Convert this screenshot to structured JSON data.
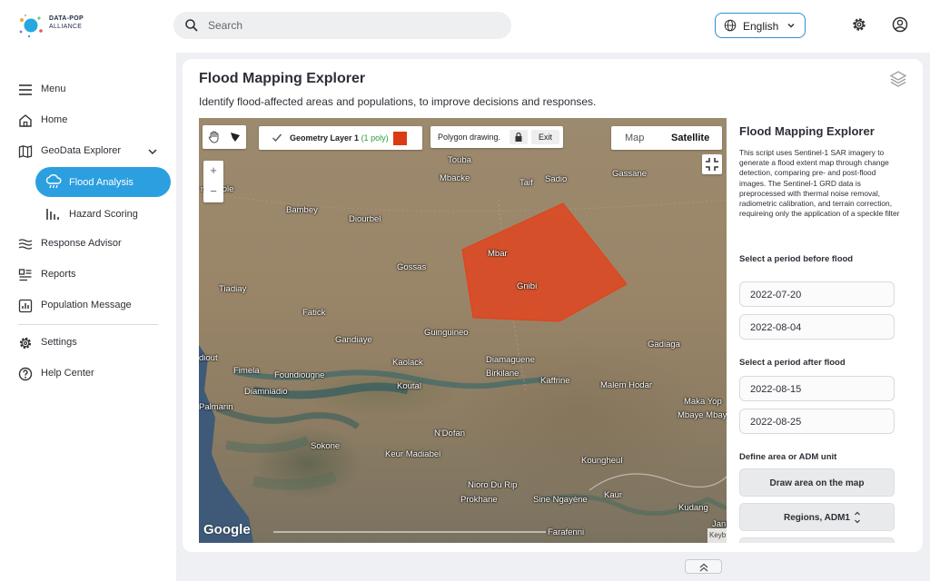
{
  "brand": {
    "line1": "DATA-POP",
    "line2": "ALLIANCE"
  },
  "search": {
    "placeholder": "Search"
  },
  "language": {
    "selected": "English"
  },
  "sidebar": {
    "items": [
      {
        "label": "Menu",
        "icon": "menu-icon"
      },
      {
        "label": "Home",
        "icon": "home-icon"
      },
      {
        "label": "GeoData Explorer",
        "icon": "map-icon"
      },
      {
        "label": "Flood Analysis",
        "icon": "cloud-rain-icon",
        "active": true
      },
      {
        "label": "Hazard Scoring",
        "icon": "bar-chart-icon"
      },
      {
        "label": "Response Advisor",
        "icon": "waves-icon"
      },
      {
        "label": "Reports",
        "icon": "reports-icon"
      },
      {
        "label": "Population Message",
        "icon": "population-icon"
      },
      {
        "label": "Settings",
        "icon": "gear-icon"
      },
      {
        "label": "Help Center",
        "icon": "help-icon"
      }
    ]
  },
  "page": {
    "title": "Flood Mapping Explorer",
    "subtitle": "Identify flood-affected areas and populations, to improve decisions and responses."
  },
  "map": {
    "geometry_layer": {
      "name": "Geometry Layer 1",
      "count": "(1 poly)",
      "color": "#dd3a12"
    },
    "polygon_drawing": "Polygon drawing.",
    "exit_label": "Exit",
    "map_type": {
      "map": "Map",
      "satellite": "Satellite"
    },
    "zoom_in": "+",
    "zoom_out": "−",
    "attribution": "Google",
    "keyboard": "Keyb",
    "places": [
      "Touba",
      "Mbacke",
      "Taif",
      "Sadio",
      "Gassane",
      "nombole",
      "Bambey",
      "Diourbel",
      "Mbar",
      "Gossas",
      "Gnibi",
      "Tiadiay",
      "Fatick",
      "Guinguineo",
      "Gandiaye",
      "Gadiaga",
      "diout",
      "Fimela",
      "Foundiougne",
      "Diamaguene",
      "Kaolack",
      "Birkilane",
      "Kaffrine",
      "Diamniadio",
      "Koutal",
      "Malem Hodar",
      "Palmarin",
      "Maka Yop",
      "Mbaye Mbaye",
      "N'Dofan",
      "Sokone",
      "Keur Madiabel",
      "Koungheul",
      "Nioro Du Rip",
      "Prokhane",
      "Sine Ngayène",
      "Kaur",
      "Kudang",
      "Farafenni",
      "Janj"
    ]
  },
  "panel": {
    "title": "Flood Mapping Explorer",
    "description": "This script uses Sentinel-1 SAR imagery to generate a flood extent map through change detection, comparing pre- and post-flood images. The Sentinel-1 GRD data is preprocessed with thermal noise removal, radiometric calibration, and terrain correction, requireing only the application of a speckle filter",
    "before_label": "Select a period before flood",
    "before_start": "2022-07-20",
    "before_end": "2022-08-04",
    "after_label": "Select a period after flood",
    "after_start": "2022-08-15",
    "after_end": "2022-08-25",
    "area_label": "Define area or ADM unit",
    "draw_button": "Draw area on the map",
    "adm_select": "Regions, ADM1"
  }
}
